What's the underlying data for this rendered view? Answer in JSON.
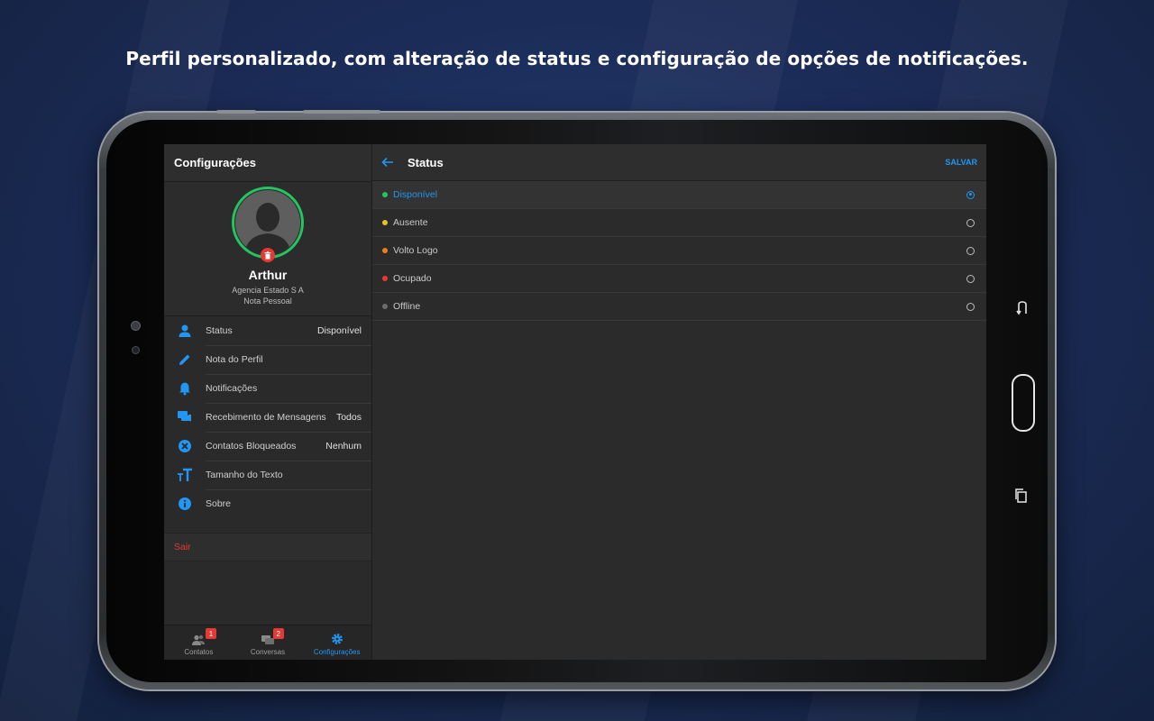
{
  "caption": "Perfil personalizado, com alteração de status e configuração de opções de notificações.",
  "left": {
    "title": "Configurações",
    "profile": {
      "name": "Arthur",
      "company": "Agencia Estado S A",
      "note": "Nota Pessoal"
    },
    "menu": [
      {
        "icon": "person-icon",
        "label": "Status",
        "value": "Disponível"
      },
      {
        "icon": "pencil-icon",
        "label": "Nota do Perfil",
        "value": ""
      },
      {
        "icon": "bell-icon",
        "label": "Notificações",
        "value": ""
      },
      {
        "icon": "chat-icon",
        "label": "Recebimento de Mensagens",
        "value": "Todos"
      },
      {
        "icon": "block-icon",
        "label": "Contatos Bloqueados",
        "value": "Nenhum"
      },
      {
        "icon": "text-size-icon",
        "label": "Tamanho do Texto",
        "value": ""
      },
      {
        "icon": "info-icon",
        "label": "Sobre",
        "value": ""
      }
    ],
    "logout": "Sair",
    "nav": [
      {
        "label": "Contatos",
        "badge": "1",
        "icon": "contacts-icon",
        "active": false
      },
      {
        "label": "Conversas",
        "badge": "2",
        "icon": "conversations-icon",
        "active": false
      },
      {
        "label": "Configurações",
        "badge": "",
        "icon": "gear-icon",
        "active": true
      }
    ]
  },
  "right": {
    "title": "Status",
    "save": "SALVAR",
    "options": [
      {
        "label": "Disponível",
        "color": "#22c55e",
        "selected": true
      },
      {
        "label": "Ausente",
        "color": "#e6c229",
        "selected": false
      },
      {
        "label": "Volto Logo",
        "color": "#f07c1e",
        "selected": false
      },
      {
        "label": "Ocupado",
        "color": "#e53935",
        "selected": false
      },
      {
        "label": "Offline",
        "color": "#6b6b6b",
        "selected": false
      }
    ]
  },
  "colors": {
    "accent": "#2196f3",
    "danger": "#e53935",
    "online": "#22c55e"
  }
}
